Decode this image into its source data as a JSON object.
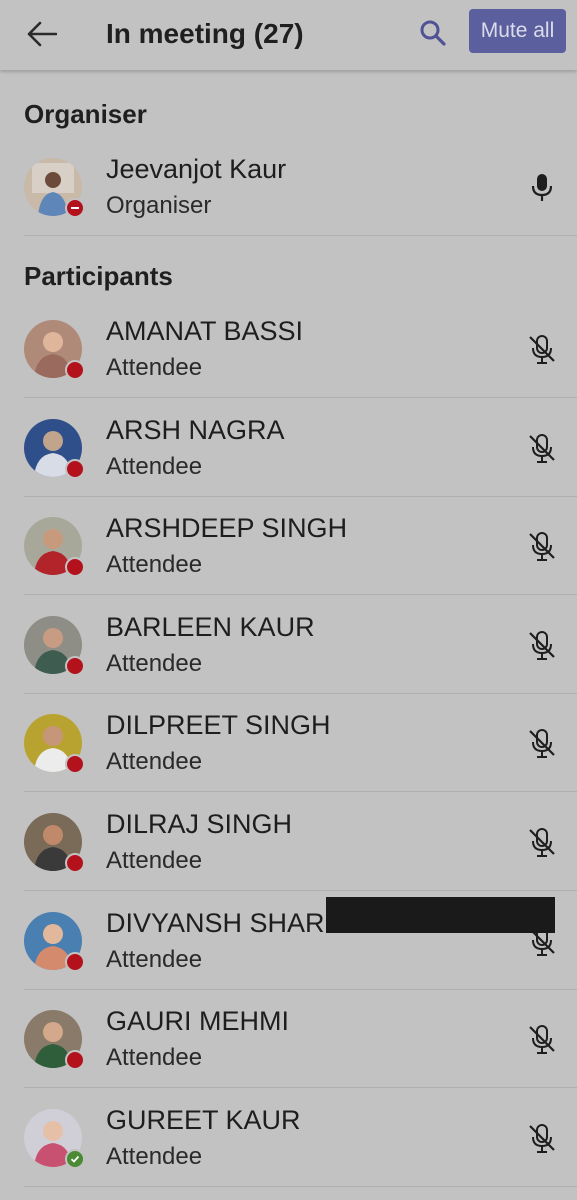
{
  "header": {
    "title": "In meeting (27)",
    "mute_all_label": "Mute all",
    "back_icon": "arrow-left-icon",
    "search_icon": "search-icon"
  },
  "organiser_section": {
    "title": "Organiser",
    "members": [
      {
        "name": "Jeevanjot Kaur",
        "role": "Organiser",
        "mic": "mic-on",
        "status": "dnd"
      }
    ]
  },
  "participants_section": {
    "title": "Participants",
    "members": [
      {
        "name": "AMANAT BASSI",
        "role": "Attendee",
        "mic": "mic-off",
        "status": "busy"
      },
      {
        "name": "ARSH NAGRA",
        "role": "Attendee",
        "mic": "mic-off",
        "status": "busy"
      },
      {
        "name": "ARSHDEEP SINGH",
        "role": "Attendee",
        "mic": "mic-off",
        "status": "busy"
      },
      {
        "name": "BARLEEN KAUR",
        "role": "Attendee",
        "mic": "mic-off",
        "status": "busy"
      },
      {
        "name": "DILPREET SINGH",
        "role": "Attendee",
        "mic": "mic-off",
        "status": "busy"
      },
      {
        "name": "DILRAJ SINGH",
        "role": "Attendee",
        "mic": "mic-off",
        "status": "busy"
      },
      {
        "name": "DIVYANSH SHAR",
        "role": "Attendee",
        "mic": "mic-off",
        "status": "busy"
      },
      {
        "name": "GAURI MEHMI",
        "role": "Attendee",
        "mic": "mic-off",
        "status": "busy"
      },
      {
        "name": "GUREET KAUR",
        "role": "Attendee",
        "mic": "mic-off",
        "status": "available"
      }
    ]
  },
  "colors": {
    "background": "#c2c2c2",
    "accent": "#5c5f9e",
    "busy": "#b3121d",
    "available": "#4a8a32"
  }
}
